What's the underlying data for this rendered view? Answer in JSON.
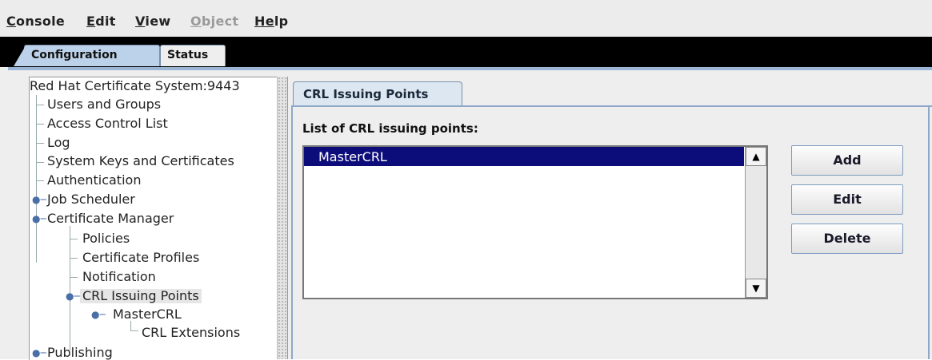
{
  "menubar": {
    "items": [
      {
        "label": "Console",
        "mnemonic": "C",
        "rest": "onsole",
        "disabled": false
      },
      {
        "label": "Edit",
        "mnemonic": "E",
        "rest": "dit",
        "disabled": false
      },
      {
        "label": "View",
        "mnemonic": "V",
        "rest": "iew",
        "disabled": false
      },
      {
        "label": "Object",
        "mnemonic": "O",
        "rest": "bject",
        "disabled": true
      },
      {
        "label": "Help",
        "mnemonic": "He",
        "rest": "lp",
        "disabled": false
      }
    ]
  },
  "top_tabs": {
    "configuration": "Configuration",
    "status": "Status"
  },
  "tree": {
    "root": "Red Hat Certificate System:9443",
    "nodes": [
      "Users and Groups",
      "Access Control List",
      "Log",
      "System Keys and Certificates",
      "Authentication",
      "Job Scheduler",
      "Certificate Manager",
      "Policies",
      "Certificate Profiles",
      "Notification",
      "CRL Issuing Points",
      "MasterCRL",
      "CRL Extensions",
      "Publishing"
    ]
  },
  "panel": {
    "tab": "CRL Issuing Points",
    "list_label": "List of CRL issuing points:",
    "list_items": [
      "MasterCRL"
    ],
    "buttons": {
      "add": "Add",
      "edit": "Edit",
      "delete": "Delete"
    }
  },
  "colors": {
    "selection": "#0c0c7a",
    "tab_active": "#bcd2ea",
    "accent_border": "#8ea8c8"
  }
}
